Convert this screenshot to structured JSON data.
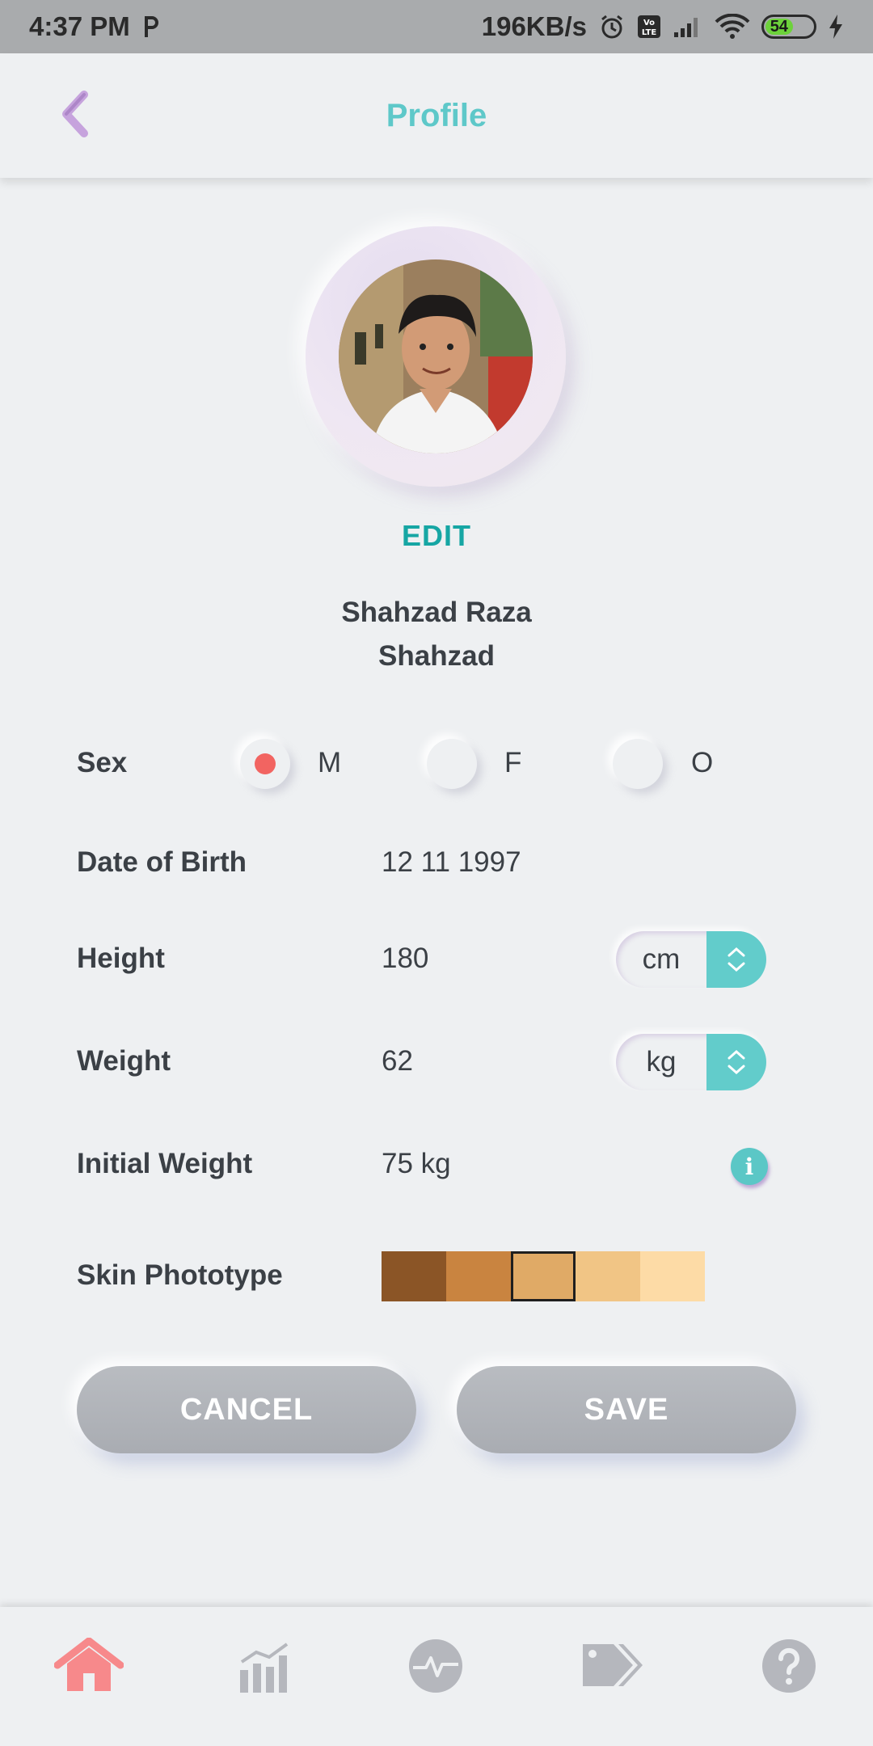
{
  "status_bar": {
    "time": "4:37 PM",
    "carrier_icon": "p-icon",
    "net_speed": "196KB/s",
    "battery_level": "54"
  },
  "header": {
    "title": "Profile",
    "back_icon": "chevron-left-icon"
  },
  "profile": {
    "edit_label": "EDIT",
    "full_name": "Shahzad Raza",
    "username": "Shahzad"
  },
  "form": {
    "sex": {
      "label": "Sex",
      "options": [
        "M",
        "F",
        "O"
      ],
      "selected": "M"
    },
    "dob": {
      "label": "Date of Birth",
      "value": "12 11 1997"
    },
    "height": {
      "label": "Height",
      "value": "180",
      "unit": "cm"
    },
    "weight": {
      "label": "Weight",
      "value": "62",
      "unit": "kg"
    },
    "initial_weight": {
      "label": "Initial Weight",
      "value": "75 kg",
      "info_icon": "i"
    },
    "skin_phototype": {
      "label": "Skin Phototype",
      "swatches": [
        "#8b5526",
        "#c98440",
        "#e0aa66",
        "#f1c585",
        "#fddba6"
      ],
      "selected_index": 2
    }
  },
  "actions": {
    "cancel_label": "CANCEL",
    "save_label": "SAVE"
  },
  "bottom_nav": {
    "items": [
      "home-icon",
      "stats-icon",
      "heartbeat-icon",
      "tags-icon",
      "help-icon"
    ],
    "active": "home-icon",
    "accent_color": "#f7898b"
  }
}
